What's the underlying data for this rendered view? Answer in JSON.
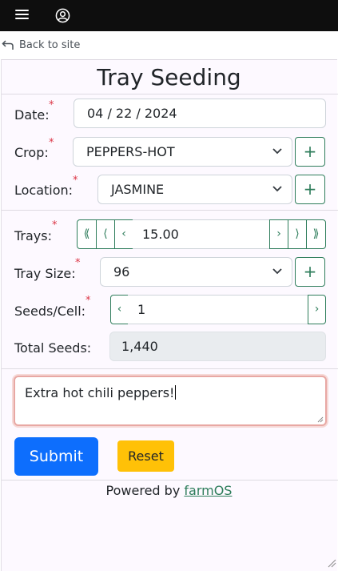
{
  "topbar": {
    "menu_icon": "hamburger-menu-icon",
    "user_icon": "user-circle-icon"
  },
  "back": {
    "icon": "back-arrow-icon",
    "label": "Back to site"
  },
  "form": {
    "title": "Tray Seeding",
    "required_mark": "*",
    "date": {
      "label": "Date:",
      "value": "04 / 22 / 2024"
    },
    "crop": {
      "label": "Crop:",
      "value": "PEPPERS-HOT",
      "add": "+"
    },
    "location": {
      "label": "Location:",
      "value": "JASMINE",
      "add": "+"
    },
    "trays": {
      "label": "Trays:",
      "value": "15.00",
      "btn_dec3": "⟪",
      "btn_dec2": "⟨",
      "btn_dec1": "‹",
      "btn_inc1": "›",
      "btn_inc2": "⟩",
      "btn_inc3": "⟫"
    },
    "tray_size": {
      "label": "Tray Size:",
      "value": "96",
      "add": "+"
    },
    "seeds_cell": {
      "label": "Seeds/Cell:",
      "value": "1",
      "btn_dec": "‹",
      "btn_inc": "›"
    },
    "total_seeds": {
      "label": "Total Seeds:",
      "value": "1,440"
    },
    "comment": {
      "value": "Extra hot chili peppers!"
    },
    "submit_label": "Submit",
    "reset_label": "Reset"
  },
  "footer": {
    "powered_by": "Powered by",
    "link": "farmOS"
  },
  "colors": {
    "topbar": "#0e0e0e",
    "accent_green": "#2e7d5b",
    "primary": "#0d6efd",
    "warning": "#ffc107",
    "required": "#dc3545"
  }
}
